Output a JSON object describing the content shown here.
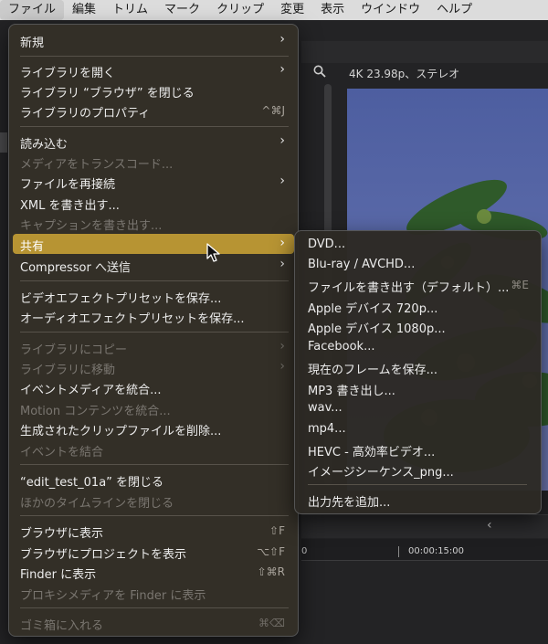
{
  "menubar": {
    "items": [
      "ファイル",
      "編集",
      "トリム",
      "マーク",
      "クリップ",
      "変更",
      "表示",
      "ウインドウ",
      "ヘルプ"
    ]
  },
  "viewer": {
    "format": "4K 23.98p、ステレオ"
  },
  "timeline": {
    "timecode_start": "0",
    "timecode": "00:00:15:00"
  },
  "file_menu": {
    "items": [
      {
        "label": "新規",
        "shortcut": "",
        "submenu": true,
        "enabled": true
      },
      {
        "label": "ライブラリを開く",
        "shortcut": "",
        "submenu": true,
        "enabled": true
      },
      {
        "label": "ライブラリ “ブラウザ” を閉じる",
        "shortcut": "",
        "submenu": false,
        "enabled": true
      },
      {
        "label": "ライブラリのプロパティ",
        "shortcut": "^⌘J",
        "submenu": false,
        "enabled": true
      },
      {
        "label": "読み込む",
        "shortcut": "",
        "submenu": true,
        "enabled": true
      },
      {
        "label": "メディアをトランスコード...",
        "shortcut": "",
        "submenu": false,
        "enabled": false
      },
      {
        "label": "ファイルを再接続",
        "shortcut": "",
        "submenu": true,
        "enabled": true
      },
      {
        "label": "XML を書き出す...",
        "shortcut": "",
        "submenu": false,
        "enabled": true
      },
      {
        "label": "キャプションを書き出す...",
        "shortcut": "",
        "submenu": false,
        "enabled": false
      },
      {
        "label": "共有",
        "shortcut": "",
        "submenu": true,
        "enabled": true
      },
      {
        "label": "Compressor へ送信",
        "shortcut": "",
        "submenu": true,
        "enabled": true
      },
      {
        "label": "ビデオエフェクトプリセットを保存...",
        "shortcut": "",
        "submenu": false,
        "enabled": true
      },
      {
        "label": "オーディオエフェクトプリセットを保存...",
        "shortcut": "",
        "submenu": false,
        "enabled": true
      },
      {
        "label": "ライブラリにコピー",
        "shortcut": "",
        "submenu": true,
        "enabled": false
      },
      {
        "label": "ライブラリに移動",
        "shortcut": "",
        "submenu": true,
        "enabled": false
      },
      {
        "label": "イベントメディアを統合...",
        "shortcut": "",
        "submenu": false,
        "enabled": true
      },
      {
        "label": "Motion コンテンツを統合...",
        "shortcut": "",
        "submenu": false,
        "enabled": false
      },
      {
        "label": "生成されたクリップファイルを削除...",
        "shortcut": "",
        "submenu": false,
        "enabled": true
      },
      {
        "label": "イベントを結合",
        "shortcut": "",
        "submenu": false,
        "enabled": false
      },
      {
        "label": "“edit_test_01a” を閉じる",
        "shortcut": "",
        "submenu": false,
        "enabled": true
      },
      {
        "label": "ほかのタイムラインを閉じる",
        "shortcut": "",
        "submenu": false,
        "enabled": false
      },
      {
        "label": "ブラウザに表示",
        "shortcut": "⇧F",
        "submenu": false,
        "enabled": true
      },
      {
        "label": "ブラウザにプロジェクトを表示",
        "shortcut": "⌥⇧F",
        "submenu": false,
        "enabled": true
      },
      {
        "label": "Finder に表示",
        "shortcut": "⇧⌘R",
        "submenu": false,
        "enabled": true
      },
      {
        "label": "プロキシメディアを Finder に表示",
        "shortcut": "",
        "submenu": false,
        "enabled": false
      },
      {
        "label": "ゴミ箱に入れる",
        "shortcut": "⌘⌫",
        "submenu": false,
        "enabled": false
      }
    ]
  },
  "share_submenu": {
    "items": [
      {
        "label": "DVD...",
        "shortcut": ""
      },
      {
        "label": "Blu-ray / AVCHD...",
        "shortcut": ""
      },
      {
        "label": "ファイルを書き出す（デフォルト）...",
        "shortcut": "⌘E"
      },
      {
        "label": "Apple デバイス 720p...",
        "shortcut": ""
      },
      {
        "label": "Apple デバイス 1080p...",
        "shortcut": ""
      },
      {
        "label": "Facebook...",
        "shortcut": ""
      },
      {
        "label": "現在のフレームを保存...",
        "shortcut": ""
      },
      {
        "label": "MP3 書き出し...",
        "shortcut": ""
      },
      {
        "label": "wav...",
        "shortcut": ""
      },
      {
        "label": "mp4...",
        "shortcut": ""
      },
      {
        "label": "HEVC - 高効率ビデオ...",
        "shortcut": ""
      },
      {
        "label": "イメージシーケンス_png...",
        "shortcut": ""
      },
      {
        "label": "出力先を追加...",
        "shortcut": ""
      }
    ]
  },
  "colors": {
    "highlight": "#b79433",
    "menu_bg": "#343028",
    "menubar_bg": "#dcdcdc"
  }
}
